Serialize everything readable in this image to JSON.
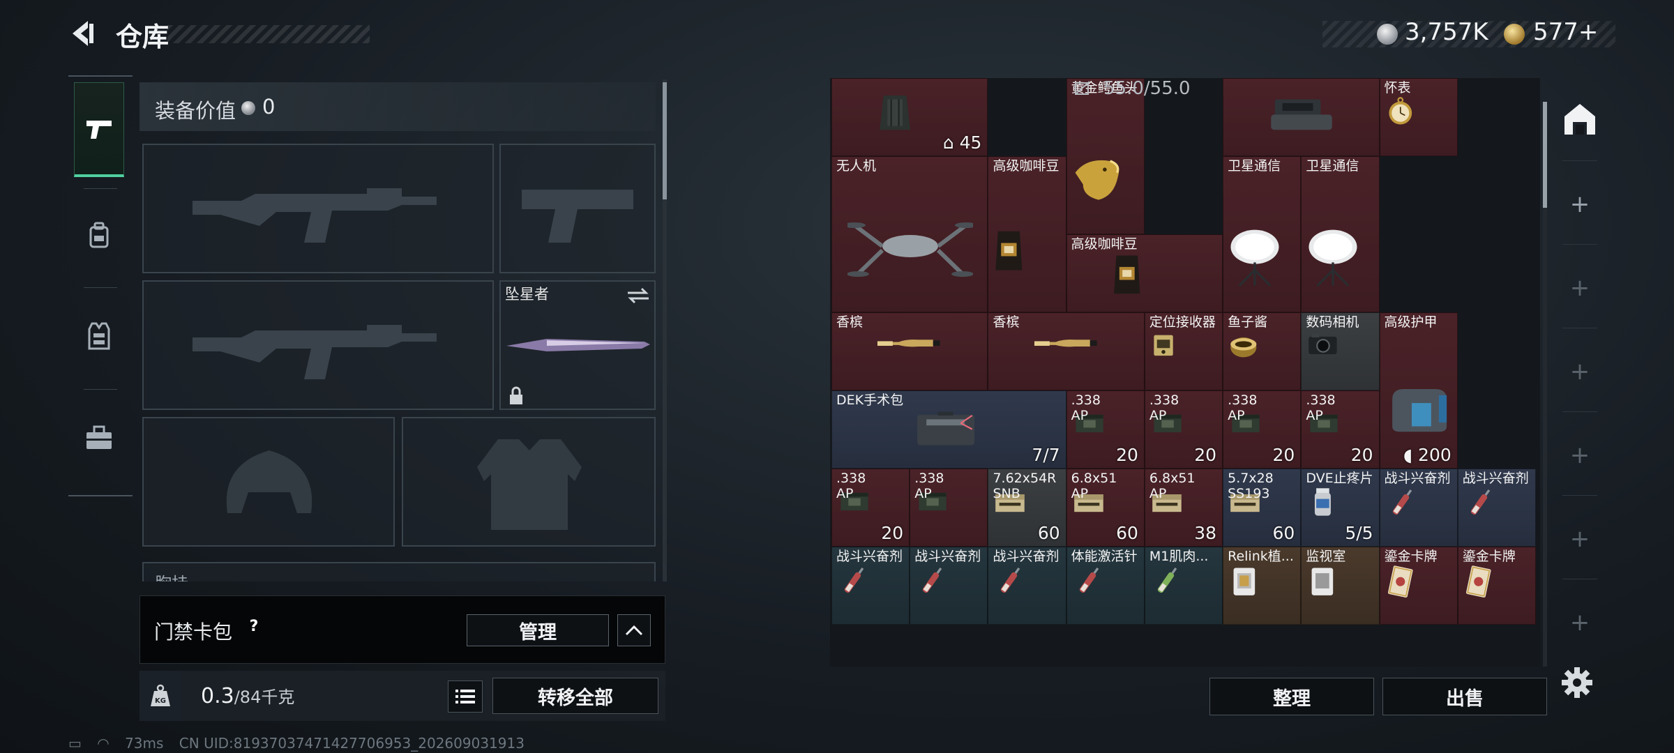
{
  "header": {
    "title": "仓库",
    "currency": {
      "silver": "3,757K",
      "gold": "577+"
    }
  },
  "nav": {
    "tabs": [
      {
        "icon": "pistol-icon",
        "active": true
      },
      {
        "icon": "backpack-icon",
        "active": false
      },
      {
        "icon": "vest-icon",
        "active": false
      },
      {
        "icon": "briefcase-icon",
        "active": false
      }
    ]
  },
  "equipment": {
    "value_label": "装备价值",
    "value": "0",
    "melee_name": "坠星者",
    "partial_label": "胸挂"
  },
  "keycard": {
    "label": "门禁卡包",
    "help": "?",
    "manage": "管理"
  },
  "weight": {
    "kg_icon": "KG",
    "current": "0.3",
    "capacity": "/84千克",
    "transfer_all": "转移全部"
  },
  "status": {
    "ping": "73ms",
    "uid": "CN UID:819370374714277069​53_202609031913"
  },
  "storage": {
    "capacity": "55.0/55.0",
    "items": [
      {
        "name": "",
        "count": "45",
        "icon": "vest-icon"
      },
      {
        "name": "黄金鳄鱼头",
        "count": "",
        "icon": "gold-croc-head-icon"
      },
      {
        "name": "",
        "count": "",
        "icon": "machine-icon"
      },
      {
        "name": "怀表",
        "count": "",
        "icon": "pocket-watch-icon"
      },
      {
        "name": "无人机",
        "count": "",
        "icon": "drone-icon"
      },
      {
        "name": "高级咖啡豆",
        "count": "",
        "icon": "coffee-bag-icon"
      },
      {
        "name": "卫星通信",
        "count": "",
        "icon": "satellite-dish-icon"
      },
      {
        "name": "卫星通信",
        "count": "",
        "icon": "satellite-dish-icon"
      },
      {
        "name": "高级咖啡豆",
        "count": "",
        "icon": "coffee-bag-icon"
      },
      {
        "name": "香槟",
        "count": "",
        "icon": "champagne-icon"
      },
      {
        "name": "香槟",
        "count": "",
        "icon": "champagne-icon"
      },
      {
        "name": "定位接收器",
        "count": "",
        "icon": "receiver-icon"
      },
      {
        "name": "鱼子酱",
        "count": "",
        "icon": "caviar-icon"
      },
      {
        "name": "数码相机",
        "count": "",
        "icon": "camera-icon"
      },
      {
        "name": "高级护甲",
        "count": "200",
        "icon": "armor-icon"
      },
      {
        "name": "DEK手术包",
        "count": "7/7",
        "icon": "surgery-kit-icon"
      },
      {
        "name": ".338\nAP",
        "count": "20",
        "icon": "ammo-box-icon"
      },
      {
        "name": ".338\nAP",
        "count": "20",
        "icon": "ammo-box-icon"
      },
      {
        "name": ".338\nAP",
        "count": "20",
        "icon": "ammo-box-icon"
      },
      {
        "name": ".338\nAP",
        "count": "20",
        "icon": "ammo-box-icon"
      },
      {
        "name": ".338\nAP",
        "count": "20",
        "icon": "ammo-box-icon"
      },
      {
        "name": ".338\nAP",
        "count": "",
        "icon": "ammo-box-icon"
      },
      {
        "name": "7.62x54R\nSNB",
        "count": "60",
        "icon": "ammo-pack-icon"
      },
      {
        "name": "6.8x51\nAP",
        "count": "60",
        "icon": "ammo-pack-icon"
      },
      {
        "name": "6.8x51\nAP",
        "count": "38",
        "icon": "ammo-pack-icon"
      },
      {
        "name": "5.7x28\nSS193",
        "count": "60",
        "icon": "ammo-pack-icon"
      },
      {
        "name": "DVE止疼片",
        "count": "5/5",
        "icon": "pill-bottle-icon"
      },
      {
        "name": "战斗兴奋剂",
        "count": "",
        "icon": "injector-icon"
      },
      {
        "name": "战斗兴奋剂",
        "count": "",
        "icon": "injector-icon"
      },
      {
        "name": "战斗兴奋剂",
        "count": "",
        "icon": "injector-icon"
      },
      {
        "name": "战斗兴奋剂",
        "count": "",
        "icon": "injector-icon"
      },
      {
        "name": "战斗兴奋剂",
        "count": "",
        "icon": "injector-icon"
      },
      {
        "name": "体能激活针",
        "count": "",
        "icon": "injector-icon"
      },
      {
        "name": "M1肌肉...",
        "count": "",
        "icon": "injector-green-icon"
      },
      {
        "name": "Relink植...",
        "count": "",
        "icon": "chip-icon"
      },
      {
        "name": "监视室",
        "count": "",
        "icon": "keycard-icon"
      },
      {
        "name": "鎏金卡牌",
        "count": "",
        "icon": "card-icon"
      },
      {
        "name": "鎏金卡牌",
        "count": "",
        "icon": "card-icon"
      }
    ]
  },
  "actions": {
    "sort": "整理",
    "sell": "出售"
  },
  "colors": {
    "accent": "#4fd0a0",
    "red_cell": "#4a2228",
    "blue_cell": "#30394c"
  }
}
